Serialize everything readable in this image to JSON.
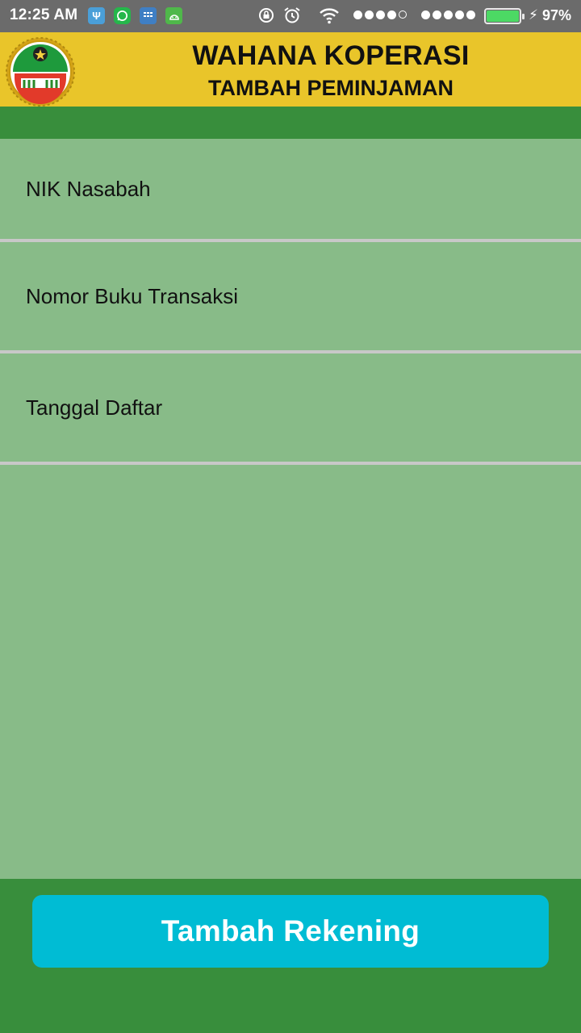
{
  "status_bar": {
    "time": "12:25 AM",
    "battery_percent": "97%",
    "battery_level": 0.97,
    "icons": [
      "usb-icon",
      "whatsapp-icon",
      "bbm-icon",
      "android-icon",
      "rotation-lock-icon",
      "alarm-icon",
      "wifi-icon",
      "signal-icon",
      "battery-icon",
      "charging-icon"
    ]
  },
  "header": {
    "title": "WAHANA KOPERASI",
    "subtitle": "TAMBAH PEMINJAMAN",
    "logo_icon": "koperasi-logo"
  },
  "form": {
    "nik_placeholder": "NIK Nasabah",
    "nomor_buku_placeholder": "Nomor Buku Transaksi",
    "tanggal_placeholder": "Tanggal Daftar"
  },
  "actions": {
    "submit_label": "Tambah Rekening"
  },
  "colors": {
    "header_bg": "#e9c52a",
    "primary_green": "#388e3c",
    "form_bg": "#88bb88",
    "button_bg": "#00bcd4"
  }
}
